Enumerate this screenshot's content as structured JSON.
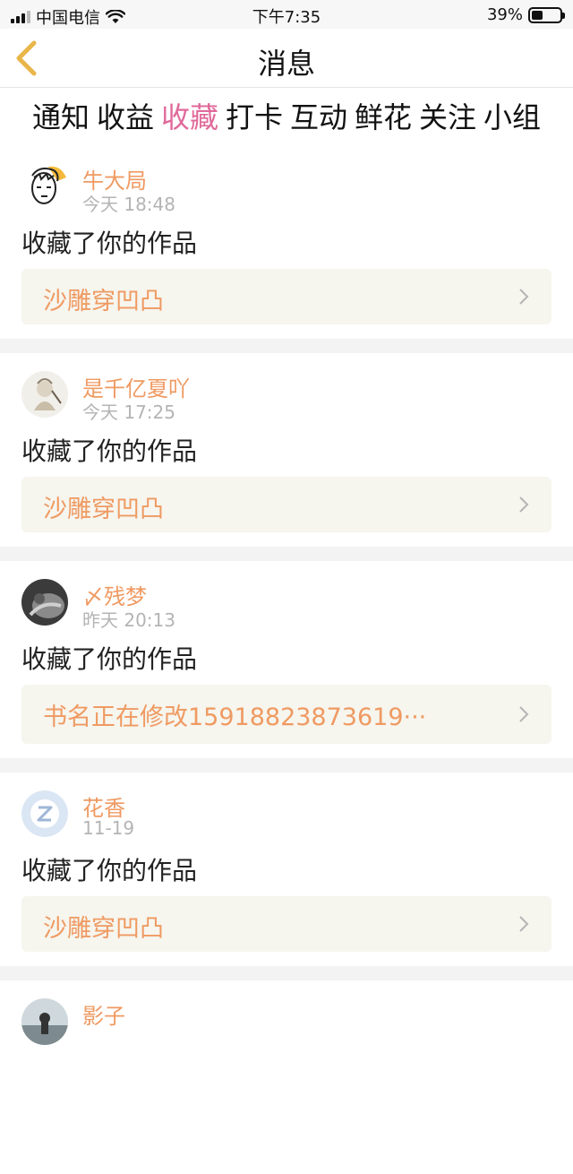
{
  "status_bar": {
    "carrier": "中国电信",
    "time": "下午7:35",
    "battery": "39%"
  },
  "nav": {
    "title": "消息"
  },
  "tabs": [
    {
      "label": "通知",
      "active": false
    },
    {
      "label": "收益",
      "active": false
    },
    {
      "label": "收藏",
      "active": true
    },
    {
      "label": "打卡",
      "active": false
    },
    {
      "label": "互动",
      "active": false
    },
    {
      "label": "鲜花",
      "active": false
    },
    {
      "label": "关注",
      "active": false
    },
    {
      "label": "小组",
      "active": false
    }
  ],
  "messages": [
    {
      "user": "牛大局",
      "time": "今天 18:48",
      "action": "收藏了你的作品",
      "work": "沙雕穿凹凸"
    },
    {
      "user": "是千亿夏吖",
      "time": "今天 17:25",
      "action": "收藏了你的作品",
      "work": "沙雕穿凹凸"
    },
    {
      "user": "〆残梦",
      "time": "昨天 20:13",
      "action": "收藏了你的作品",
      "work": "书名正在修改15918823873619···"
    },
    {
      "user": "花香",
      "time": "11-19",
      "action": "收藏了你的作品",
      "work": "沙雕穿凹凸"
    },
    {
      "user": "影子"
    }
  ],
  "colors": {
    "accent_pink": "#e0699a",
    "username_orange": "#ef9a62",
    "work_box_bg": "#f6f5ee",
    "back_arrow": "#e8b64a"
  },
  "icons": {
    "back": "chevron-left-icon",
    "work_arrow": "chevron-right-icon",
    "wifi": "wifi-icon"
  }
}
